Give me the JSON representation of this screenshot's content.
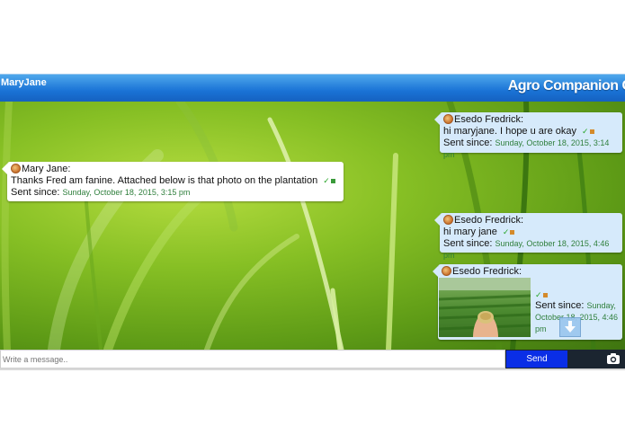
{
  "header": {
    "user_name": "MaryJane",
    "app_title": "Agro Companion Chat"
  },
  "messages": [
    {
      "sender": "Esedo Fredrick:",
      "text": "hi maryjane. I hope u are okay",
      "since_label": "Sent since:",
      "since_value": "Sunday, October 18, 2015, 3:14 pm"
    },
    {
      "sender": "Mary Jane:",
      "text": "Thanks Fred am fanine. Attached below is that photo on the plantation",
      "since_label": "Sent since:",
      "since_value": "Sunday, October 18, 2015, 3:15 pm"
    },
    {
      "sender": "Esedo Fredrick:",
      "text": "hi mary jane",
      "since_label": "Sent since:",
      "since_value": "Sunday, October 18, 2015, 4:46 pm"
    },
    {
      "sender": "Esedo Fredrick:",
      "since_label": "Sent since:",
      "since_value": "Sunday, October 18, 2015, 4:46 pm"
    }
  ],
  "composer": {
    "placeholder": "Write a message..",
    "send_label": "Send"
  },
  "icons": {
    "camera": "camera-icon",
    "scroll": "arrow-down-icon",
    "read_receipt": "check-icon"
  },
  "colors": {
    "header_blue": "#1a73d6",
    "send_blue": "#0a2ee6",
    "bubble_blue": "#d6eafb",
    "timestamp_green": "#2f7f3c"
  }
}
